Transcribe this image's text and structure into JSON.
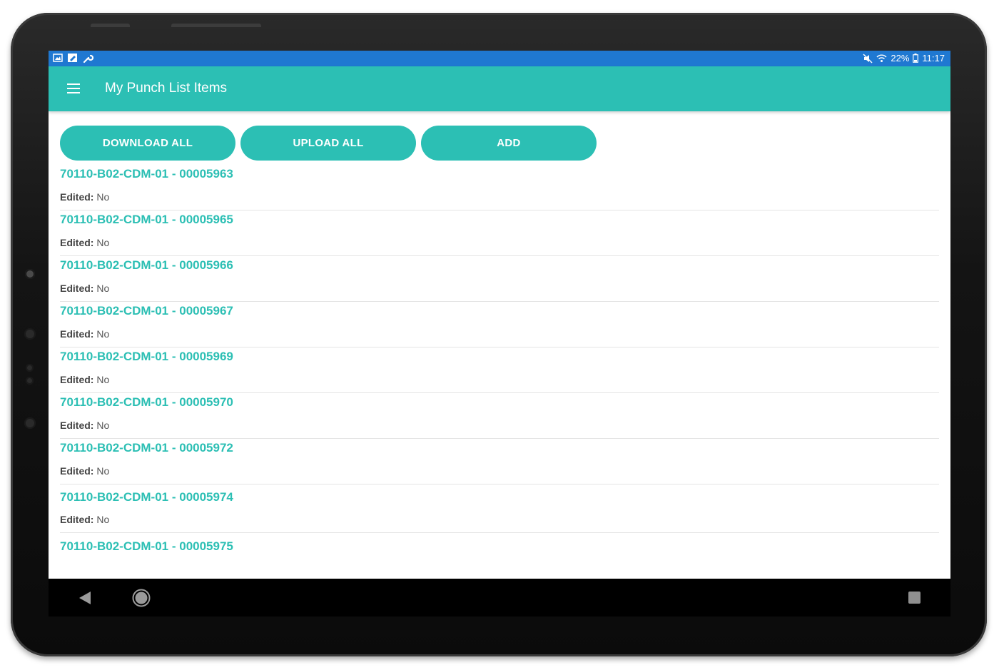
{
  "status_bar": {
    "left_icons": [
      "image-icon",
      "note-icon",
      "wrench-icon"
    ],
    "right_icons": [
      "mute-icon",
      "wifi-icon",
      "battery-icon"
    ],
    "battery": "22%",
    "time": "11:17"
  },
  "app_bar": {
    "title": "My Punch List Items",
    "menu_icon": "hamburger-menu-icon"
  },
  "actions": {
    "download_all": "DOWNLOAD ALL",
    "upload_all": "UPLOAD ALL",
    "add": "ADD"
  },
  "list": {
    "edited_label": "Edited:",
    "items": [
      {
        "title": "70110-B02-CDM-01 - 00005963",
        "edited": "No"
      },
      {
        "title": "70110-B02-CDM-01 - 00005965",
        "edited": "No"
      },
      {
        "title": "70110-B02-CDM-01 - 00005966",
        "edited": "No"
      },
      {
        "title": "70110-B02-CDM-01 - 00005967",
        "edited": "No"
      },
      {
        "title": "70110-B02-CDM-01 - 00005969",
        "edited": "No"
      },
      {
        "title": "70110-B02-CDM-01 - 00005970",
        "edited": "No"
      },
      {
        "title": "70110-B02-CDM-01 - 00005972",
        "edited": "No"
      },
      {
        "title": "70110-B02-CDM-01 - 00005974",
        "edited": "No"
      },
      {
        "title": "70110-B02-CDM-01 - 00005975"
      }
    ]
  },
  "nav_bar": {
    "icons": [
      "back-icon",
      "home-icon",
      "recent-apps-icon"
    ]
  },
  "colors": {
    "status_bar": "#1f78d1",
    "accent": "#2cbfb4",
    "nav_bar": "#000000",
    "divider": "#e4e4e4"
  }
}
